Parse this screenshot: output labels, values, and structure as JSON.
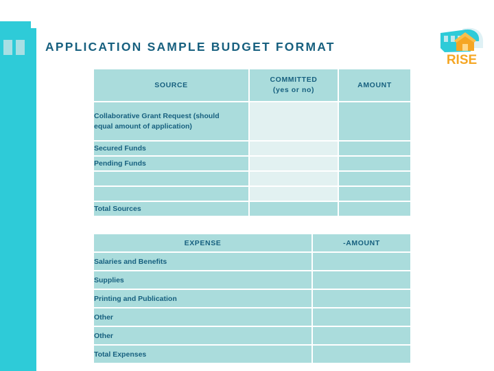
{
  "page": {
    "title": "APPLICATION SAMPLE BUDGET FORMAT",
    "title_color": "#17607f",
    "accent_color": "#2ecbd8",
    "cell_color": "#aadcdc",
    "cell_light_color": "#e2f1f1",
    "background": "#ffffff"
  },
  "logo": {
    "name": "rise-logo",
    "wordmark": "RISE",
    "wordmark_color": "#f5a623",
    "shape_color": "#2ecbd8",
    "house_color": "#f5a623"
  },
  "decoration": {
    "name": "left-bar",
    "color": "#2ecbd8",
    "square_color": "#a8dfe4"
  },
  "sources_table": {
    "name": "sources-table",
    "headers": [
      "SOURCE",
      "COMMITTED (yes or no)",
      "AMOUNT"
    ],
    "header_source": "SOURCE",
    "header_committed_line1": "COMMITTED",
    "header_committed_line2": "(yes or no)",
    "header_amount": "AMOUNT",
    "rows": [
      {
        "label": "Collaborative Grant Request (should equal amount of application)",
        "label_line1": "Collaborative Grant Request (should",
        "label_line2": "equal amount of application)",
        "committed": "",
        "amount": ""
      },
      {
        "label": "Secured Funds",
        "committed": "",
        "amount": ""
      },
      {
        "label": "Pending Funds",
        "committed": "",
        "amount": ""
      },
      {
        "label": "",
        "committed": "",
        "amount": ""
      },
      {
        "label": "",
        "committed": "",
        "amount": ""
      },
      {
        "label": "Total Sources",
        "committed": "",
        "amount": ""
      }
    ]
  },
  "expense_table": {
    "name": "expense-table",
    "header_expense": "EXPENSE",
    "header_amount": "-AMOUNT",
    "rows": [
      {
        "label": "Salaries and Benefits",
        "amount": ""
      },
      {
        "label": "Supplies",
        "amount": ""
      },
      {
        "label": "Printing and Publication",
        "amount": ""
      },
      {
        "label": "Other",
        "amount": ""
      },
      {
        "label": "Other",
        "amount": ""
      },
      {
        "label": "Total Expenses",
        "amount": ""
      }
    ]
  }
}
